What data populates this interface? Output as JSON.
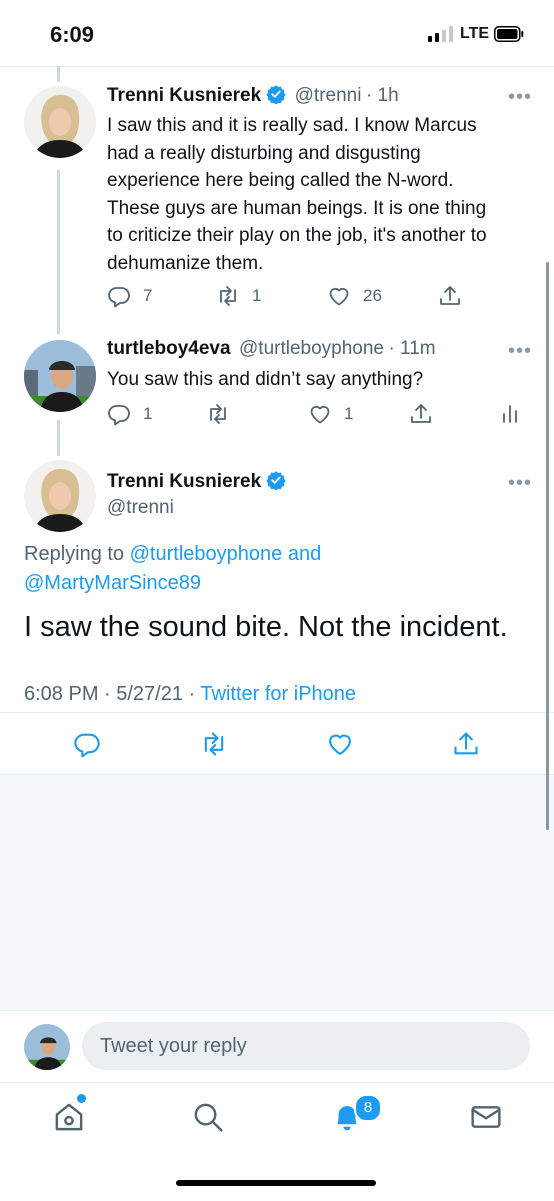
{
  "status": {
    "time": "6:09",
    "network": "LTE"
  },
  "tweet1": {
    "name": "Trenni Kusnierek",
    "handle": "@trenni",
    "time": "· 1h",
    "more": "•••",
    "text": "I saw this and it is really sad. I know Marcus had a really disturbing and disgusting experience here being called the N-word. These guys are human beings. It is one thing to criticize their play on the job, it's another to dehumanize them.",
    "replies": "7",
    "retweets": "1",
    "likes": "26"
  },
  "tweet2": {
    "name": "turtleboy4eva",
    "handle": "@turtleboyphone",
    "time": "· 11m",
    "more": "•••",
    "text": "You saw this and didn’t say anything?",
    "replies": "1",
    "likes": "1"
  },
  "main_tweet": {
    "name": "Trenni Kusnierek",
    "handle": "@trenni",
    "more": "•••",
    "replying_prefix": "Replying to ",
    "replying_user1": "@turtleboyphone",
    "replying_and": " and",
    "replying_user2": "@MartyMarSince89",
    "text": "I saw the sound bite. Not the incident.",
    "timestamp": "6:08 PM · 5/27/21 · ",
    "source": "Twitter for iPhone"
  },
  "reply_bar": {
    "placeholder": "Tweet your reply"
  },
  "tabbar": {
    "notifications_count": "8"
  },
  "colors": {
    "accent": "#1d9bf0",
    "text": "#0f1419",
    "muted": "#536471",
    "verified": "#1d9bf0"
  }
}
